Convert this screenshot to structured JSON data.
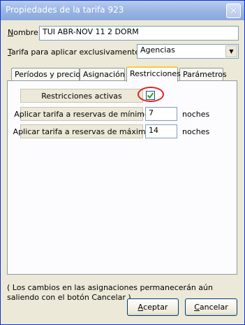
{
  "window": {
    "title": "Propiedades de la tarifa 923"
  },
  "nombre": {
    "label_accel": "N",
    "label_rest": "ombre",
    "value": "TUI ABR-NOV 11 2 DORM"
  },
  "tarifa": {
    "label_accel": "T",
    "label_rest": "arifa para aplicar exclusivamente a",
    "selected": "Agencias"
  },
  "tabs": [
    {
      "label": "Períodos y precios"
    },
    {
      "label": "Asignación"
    },
    {
      "label": "Restricciones"
    },
    {
      "label": "Parámetros"
    }
  ],
  "restricciones": {
    "activas_label": "Restricciones activas",
    "activas_checked": true,
    "minimo_label": "Aplicar tarifa a reservas de mínimo",
    "minimo_value": "7",
    "minimo_unit": "noches",
    "maximo_label": "Aplicar tarifa a reservas de máximo",
    "maximo_value": "14",
    "maximo_unit": "noches"
  },
  "note": "( Los cambios en las asignaciones permanecerán aún saliendo con el botón Cancelar )",
  "buttons": {
    "aceptar_accel": "A",
    "aceptar_rest": "ceptar",
    "cancelar_accel": "C",
    "cancelar_rest": "ancelar"
  }
}
